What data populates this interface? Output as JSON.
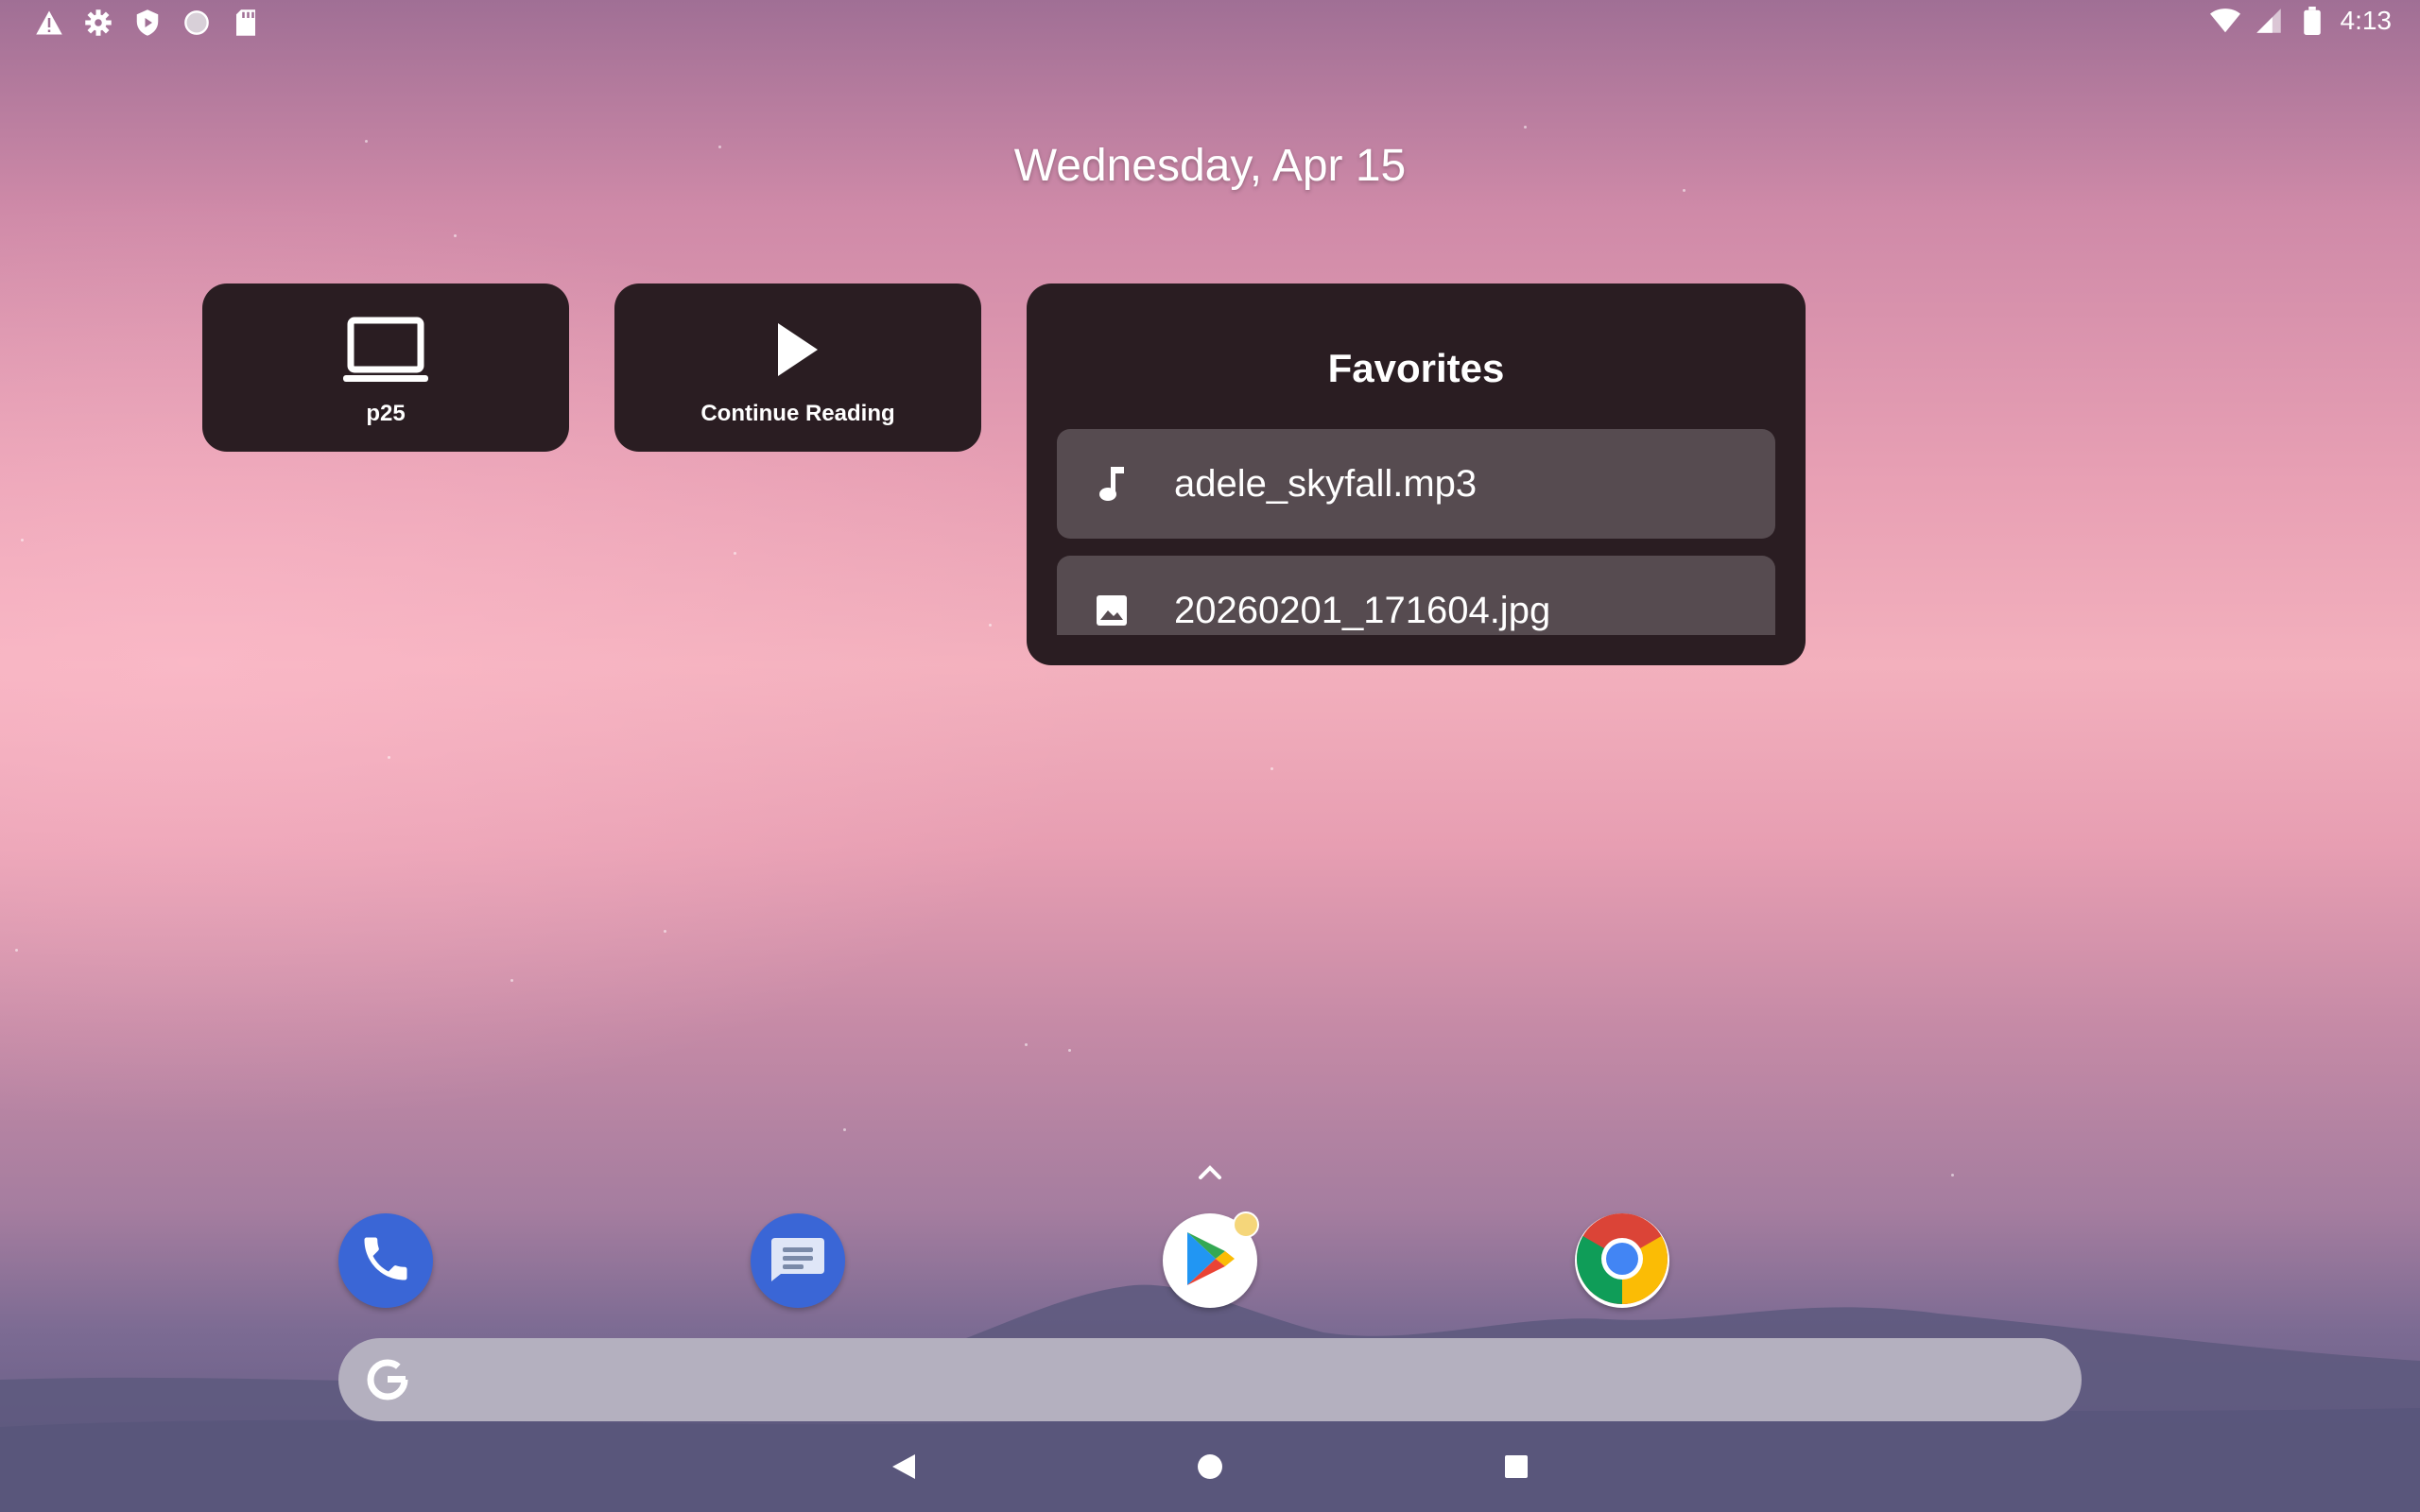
{
  "statusbar": {
    "left_icons": [
      "warning-icon",
      "settings-gear-icon",
      "shield-play-icon",
      "circle-icon",
      "sd-card-icon"
    ],
    "right_icons": [
      "wifi-icon",
      "cell-signal-icon",
      "battery-icon"
    ],
    "time": "4:13"
  },
  "home": {
    "date": "Wednesday, Apr 15"
  },
  "widgets": {
    "device": {
      "label": "p25",
      "icon": "laptop-icon"
    },
    "reading": {
      "label": "Continue Reading",
      "icon": "play-icon"
    },
    "favorites": {
      "title": "Favorites",
      "items": [
        {
          "name": "adele_skyfall.mp3",
          "icon": "music-note-icon"
        },
        {
          "name": "20260201_171604.jpg",
          "icon": "image-icon"
        }
      ]
    }
  },
  "dock": {
    "apps": [
      {
        "name": "Phone",
        "icon": "phone-icon",
        "color": "#3a66d6"
      },
      {
        "name": "Messages",
        "icon": "messages-icon",
        "color": "#3a66d6"
      },
      {
        "name": "Play Store",
        "icon": "play-store-icon",
        "color": "#ffffff"
      },
      {
        "name": "Chrome",
        "icon": "chrome-icon",
        "color": "#ffffff"
      }
    ],
    "app_drawer_icon": "chevron-up-icon"
  },
  "search": {
    "icon": "google-g-icon"
  },
  "navigation": {
    "back": "back-icon",
    "home": "home-icon",
    "recents": "recents-icon"
  }
}
